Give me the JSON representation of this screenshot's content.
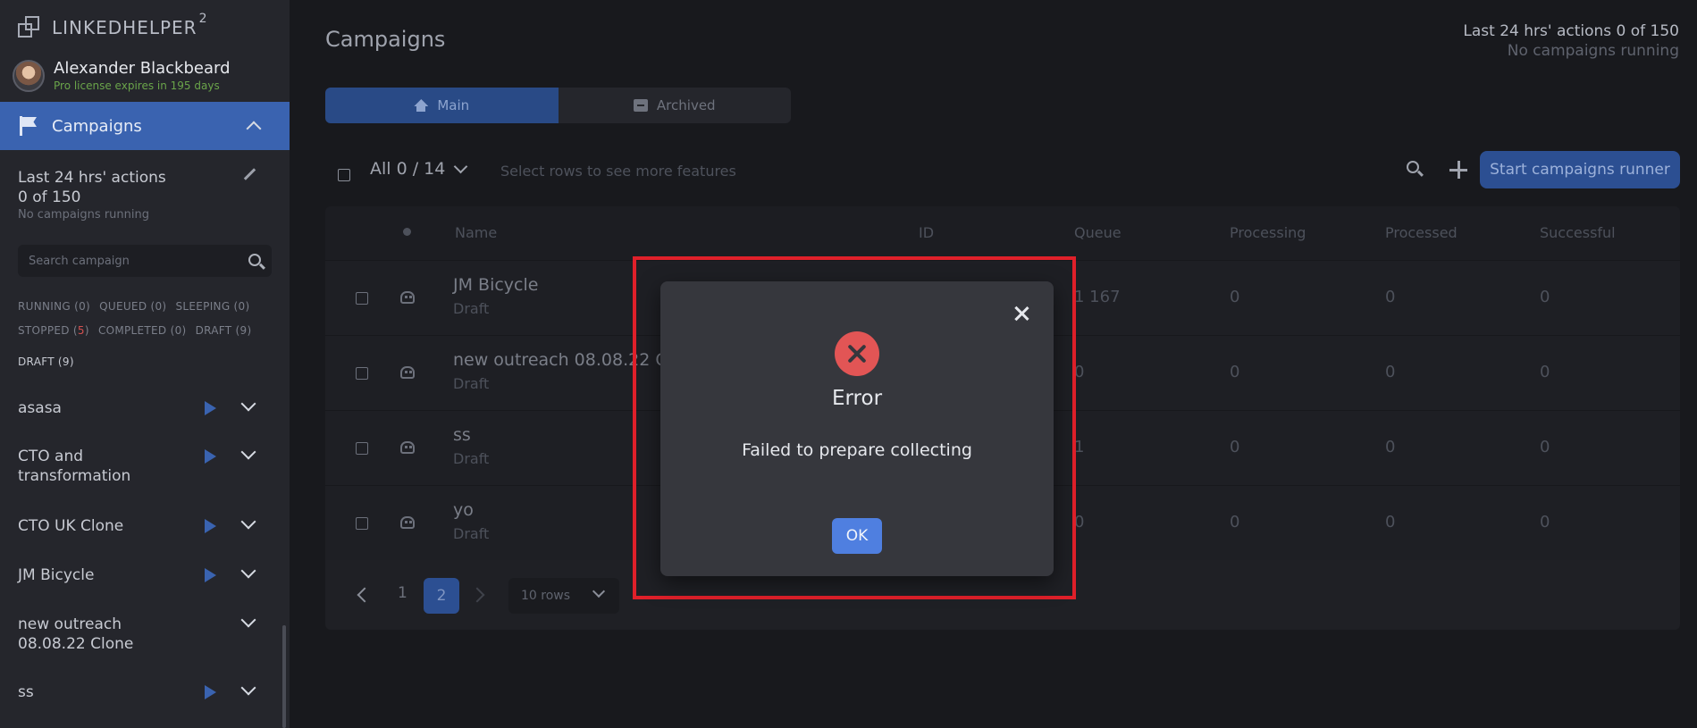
{
  "app": {
    "brand": "LINKEDHELPER",
    "brand_sup": "2"
  },
  "user": {
    "name": "Alexander Blackbeard",
    "license": "Pro license expires in 195 days"
  },
  "nav": {
    "active_label": "Campaigns"
  },
  "sidebar_stats": {
    "line1": "Last 24 hrs' actions",
    "line2": "0 of 150",
    "line3": "No campaigns running"
  },
  "sidebar_search": {
    "placeholder": "Search campaign"
  },
  "filters": {
    "running": "RUNNING (0)",
    "queued": "QUEUED (0)",
    "sleeping": "SLEEPING (0)",
    "stopped_label": "STOPPED (",
    "stopped_count": "5",
    "stopped_close": ")",
    "completed": "COMPLETED (0)",
    "draft": "DRAFT (9)",
    "draft_active": "DRAFT (9)"
  },
  "campaign_list": [
    {
      "name": "asasa",
      "has_play": true
    },
    {
      "name": "CTO and transformation",
      "has_play": true
    },
    {
      "name": "CTO UK Clone",
      "has_play": true
    },
    {
      "name": "JM Bicycle",
      "has_play": true
    },
    {
      "name": "new outreach 08.08.22 Clone",
      "has_play": false
    },
    {
      "name": "ss",
      "has_play": true
    }
  ],
  "header": {
    "title": "Campaigns",
    "actions_line": "Last 24 hrs' actions 0 of 150",
    "running_line": "No campaigns running"
  },
  "tabs": [
    {
      "label": "Main",
      "icon": "home-icon",
      "active": true
    },
    {
      "label": "Archived",
      "icon": "archive-icon",
      "active": false
    }
  ],
  "toolbar": {
    "selection": "All 0 / 14",
    "hint": "Select rows to see more features",
    "start_label": "Start campaigns runner"
  },
  "table": {
    "columns": [
      "Name",
      "ID",
      "Queue",
      "Processing",
      "Processed",
      "Successful"
    ],
    "rows": [
      {
        "name": "JM Bicycle",
        "status": "Draft",
        "queue": "1 167",
        "processing": "0",
        "processed": "0",
        "successful": "0"
      },
      {
        "name": "new outreach 08.08.22 Clone",
        "status": "Draft",
        "queue": "0",
        "processing": "0",
        "processed": "0",
        "successful": "0"
      },
      {
        "name": "ss",
        "status": "Draft",
        "queue": "1",
        "processing": "0",
        "processed": "0",
        "successful": "0"
      },
      {
        "name": "yo",
        "status": "Draft",
        "queue": "0",
        "processing": "0",
        "processed": "0",
        "successful": "0"
      }
    ]
  },
  "pagination": {
    "pages": [
      "1",
      "2"
    ],
    "current": "2",
    "rows_per_page": "10 rows"
  },
  "dialog": {
    "title": "Error",
    "message": "Failed to prepare collecting",
    "ok_label": "OK"
  },
  "colors": {
    "accent": "#3a63b0",
    "error": "#e25555",
    "highlight_frame": "#e0202a"
  }
}
